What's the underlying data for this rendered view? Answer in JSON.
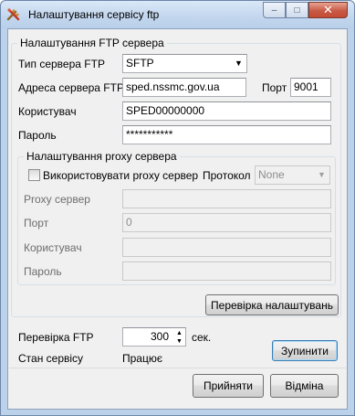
{
  "window": {
    "title": "Налаштування сервісу ftp",
    "minimize_glyph": "–",
    "maximize_glyph": "□",
    "close_glyph": "✕"
  },
  "ftp_group": {
    "title": "Налаштування FTP сервера",
    "server_type_label": "Тип сервера FTP",
    "server_type_value": "SFTP",
    "address_label": "Адреса сервера FTP",
    "address_value": "sped.nssmc.gov.ua",
    "port_label": "Порт",
    "port_value": "9001",
    "user_label": "Користувач",
    "user_value": "SPED00000000",
    "password_label": "Пароль",
    "password_value": "***********"
  },
  "proxy_group": {
    "title": "Налаштування proxy сервера",
    "use_proxy_label": "Використовувати proxy сервер",
    "protocol_label": "Протокол",
    "protocol_value": "None",
    "proxy_server_label": "Proxy сервер",
    "proxy_server_value": "",
    "port_label": "Порт",
    "port_value": "0",
    "user_label": "Користувач",
    "user_value": "",
    "password_label": "Пароль",
    "password_value": ""
  },
  "check_settings_button": "Перевірка налаштувань",
  "check_ftp": {
    "label": "Перевірка FTP",
    "value": "300",
    "unit": "сек."
  },
  "service_status": {
    "label": "Стан сервісу",
    "value": "Працює",
    "stop_button": "Зупинити"
  },
  "footer": {
    "accept_button": "Прийняти",
    "cancel_button": "Відміна"
  },
  "icons": {
    "dropdown": "▼",
    "spin_up": "▲",
    "spin_down": "▼"
  }
}
